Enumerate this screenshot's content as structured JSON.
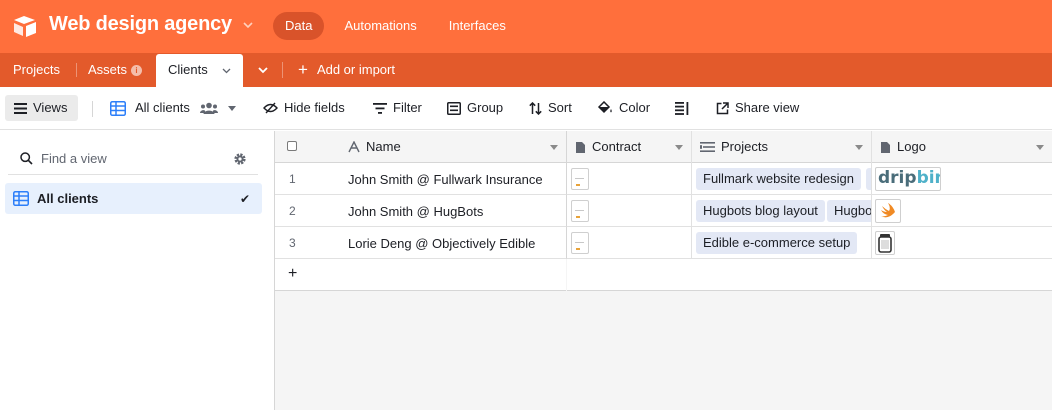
{
  "header": {
    "base_title": "Web design agency",
    "nav": [
      {
        "label": "Data",
        "active": true
      },
      {
        "label": "Automations",
        "active": false
      },
      {
        "label": "Interfaces",
        "active": false
      }
    ],
    "brand_color": "#ff6f3c"
  },
  "tables": {
    "items": [
      {
        "label": "Projects"
      },
      {
        "label": "Assets"
      },
      {
        "label": "Clients",
        "active": true
      }
    ],
    "add_import_label": "Add or import"
  },
  "toolbar": {
    "views_label": "Views",
    "current_view": "All clients",
    "hide_fields_label": "Hide fields",
    "filter_label": "Filter",
    "group_label": "Group",
    "sort_label": "Sort",
    "color_label": "Color",
    "share_label": "Share view"
  },
  "sidebar": {
    "search_placeholder": "Find a view",
    "views": [
      {
        "label": "All clients",
        "selected": true
      }
    ]
  },
  "grid": {
    "columns": [
      {
        "label": "Name",
        "icon": "text-field-icon"
      },
      {
        "label": "Contract",
        "icon": "attachment-icon"
      },
      {
        "label": "Projects",
        "icon": "linked-record-icon"
      },
      {
        "label": "Logo",
        "icon": "attachment-icon"
      }
    ],
    "rows": [
      {
        "num": "1",
        "name": "John Smith @ Fullwark Insurance",
        "projects": [
          "Fullmark website redesign",
          ""
        ],
        "logo": "dripbin"
      },
      {
        "num": "2",
        "name": "John Smith @ HugBots",
        "projects": [
          "Hugbots blog layout",
          "Hugbots"
        ],
        "logo": "swift-logo"
      },
      {
        "num": "3",
        "name": "Lorie Deng @ Objectively Edible",
        "projects": [
          "Edible e-commerce setup"
        ],
        "logo": "jar-logo"
      }
    ],
    "logo_texts": {
      "drip": "drip",
      "bin": "bin"
    }
  }
}
